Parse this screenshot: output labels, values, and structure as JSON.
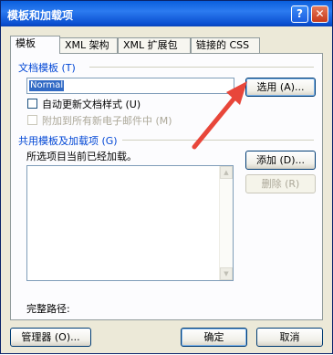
{
  "window": {
    "title": "模板和加载项",
    "help_label": "?",
    "close_label": "✕"
  },
  "tabs": [
    {
      "label": "模板",
      "active": true
    },
    {
      "label": "XML 架构",
      "active": false
    },
    {
      "label": "XML 扩展包",
      "active": false
    },
    {
      "label": "链接的 CSS",
      "active": false
    }
  ],
  "document_template": {
    "section_title": "文档模板 (T)",
    "value": "Normal",
    "attach_button": "选用 (A)...",
    "auto_update_label": "自动更新文档样式 (U)",
    "auto_update_checked": false,
    "attach_email_label": "附加到所有新电子邮件中 (M)",
    "attach_email_checked": false,
    "attach_email_disabled": true
  },
  "global_templates": {
    "section_title": "共用模板及加载项 (G)",
    "caption": "所选项目当前已经加载。",
    "items": [],
    "add_button": "添加 (D)...",
    "remove_button": "删除 (R)",
    "remove_disabled": true
  },
  "full_path_label": "完整路径:",
  "footer": {
    "organizer_button": "管理器 (O)...",
    "ok_button": "确定",
    "cancel_button": "取消"
  },
  "colors": {
    "annotation_arrow": "#e8463a",
    "section_title": "#0046d5",
    "title_bar": "#0a5fdd"
  }
}
